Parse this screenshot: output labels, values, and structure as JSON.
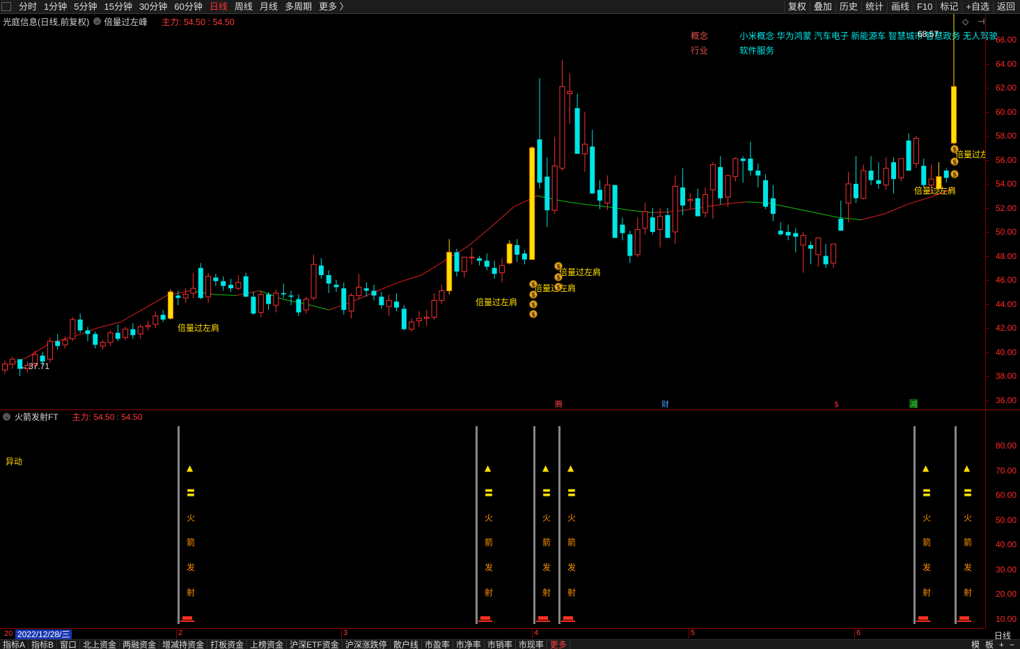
{
  "toolbar": {
    "timeframes": [
      "分时",
      "1分钟",
      "5分钟",
      "15分钟",
      "30分钟",
      "60分钟",
      "日线",
      "周线",
      "月线",
      "多周期",
      "更多 〉"
    ],
    "active_timeframe": "日线",
    "right_tools": [
      "复权",
      "叠加",
      "历史",
      "统计",
      "画线",
      "F10",
      "标记",
      "+自选",
      "返回"
    ]
  },
  "chart_header": {
    "stock_name": "光庭信息(日线,前复权)",
    "indicator_name": "倍量过左峰",
    "main_force": "主力: 54.50 : 54.50"
  },
  "concept_panel": {
    "concept_label": "概念",
    "concept_value": "小米概念 华为鸿蒙 汽车电子 新能源车 智慧城市 智慧政务 无人驾驶",
    "industry_label": "行业",
    "industry_value": "软件服务",
    "overlay_text": "68.57"
  },
  "price_axis": [
    "66.00",
    "64.00",
    "62.00",
    "60.00",
    "58.00",
    "56.00",
    "54.00",
    "52.00",
    "50.00",
    "48.00",
    "46.00",
    "44.00",
    "42.00",
    "40.00",
    "38.00",
    "36.00"
  ],
  "min_label": "←37.71",
  "signal_label": "倍量过左肩",
  "event_markers": [
    "腾",
    "财",
    "$",
    "减"
  ],
  "sub_panel": {
    "title": "火箭发射FT",
    "main_force": "主力: 54.50 : 54.50",
    "yidong_label": "异动",
    "axis": [
      "80.00",
      "70.00",
      "60.00",
      "50.00",
      "40.00",
      "30.00",
      "20.00",
      "10.00"
    ],
    "rocket_chars": [
      "▲",
      "〓",
      "火",
      "箭",
      "发",
      "射"
    ]
  },
  "date_bar": {
    "start_clip": "20",
    "selected_date": "2022/12/28/三",
    "months": [
      "2",
      "3",
      "4",
      "5",
      "6"
    ]
  },
  "period_label": "日线",
  "bottom_tabs": [
    "指标A",
    "指标B",
    "窗口",
    "北上资金",
    "两融资金",
    "增减持资金",
    "打板资金",
    "上榜资金",
    "沪深ETF资金",
    "沪深涨跌停",
    "散户线",
    "市盈率",
    "市净率",
    "市销率",
    "市现率",
    "更多"
  ],
  "bottom_right": [
    "模",
    "板",
    "+",
    "−"
  ],
  "chart_data": {
    "type": "candlestick",
    "ylim": [
      35,
      67
    ],
    "candles": [
      [
        38.5,
        39.3,
        38.2,
        39.0
      ],
      [
        39.0,
        39.6,
        38.6,
        39.4
      ],
      [
        39.4,
        39.4,
        38.0,
        38.6
      ],
      [
        38.6,
        39.2,
        38.3,
        38.9
      ],
      [
        38.9,
        40.1,
        38.7,
        39.8
      ],
      [
        39.7,
        40.0,
        38.9,
        39.2
      ],
      [
        39.4,
        41.2,
        39.1,
        40.9
      ],
      [
        40.9,
        41.5,
        40.2,
        40.5
      ],
      [
        40.6,
        41.3,
        40.3,
        41.0
      ],
      [
        41.1,
        42.9,
        40.9,
        42.7
      ],
      [
        42.7,
        43.2,
        41.6,
        41.8
      ],
      [
        41.8,
        42.1,
        40.9,
        41.5
      ],
      [
        41.5,
        41.7,
        40.3,
        40.6
      ],
      [
        40.5,
        41.0,
        40.2,
        40.8
      ],
      [
        40.8,
        41.8,
        40.5,
        41.6
      ],
      [
        41.6,
        42.3,
        40.9,
        41.1
      ],
      [
        41.2,
        42.1,
        41.0,
        41.9
      ],
      [
        41.9,
        42.4,
        41.1,
        41.4
      ],
      [
        41.5,
        42.3,
        41.1,
        42.1
      ],
      [
        42.1,
        42.6,
        41.8,
        42.2
      ],
      [
        42.3,
        43.4,
        42.0,
        43.0
      ],
      [
        43.1,
        43.5,
        42.5,
        42.7
      ],
      [
        42.8,
        45.2,
        42.7,
        45.0
      ],
      [
        44.7,
        45.1,
        43.9,
        44.5
      ],
      [
        44.5,
        45.3,
        44.1,
        44.8
      ],
      [
        44.9,
        46.6,
        44.5,
        45.3
      ],
      [
        47.0,
        47.4,
        44.4,
        44.5
      ],
      [
        44.6,
        46.6,
        44.1,
        46.3
      ],
      [
        46.2,
        46.5,
        45.5,
        45.9
      ],
      [
        45.9,
        46.3,
        45.1,
        45.5
      ],
      [
        45.6,
        46.1,
        45.0,
        45.3
      ],
      [
        45.3,
        46.4,
        45.1,
        45.8
      ],
      [
        46.3,
        46.6,
        44.7,
        44.6
      ],
      [
        44.6,
        45.0,
        43.1,
        43.2
      ],
      [
        43.3,
        45.1,
        42.9,
        44.8
      ],
      [
        44.8,
        45.0,
        43.5,
        44.0
      ],
      [
        43.9,
        45.2,
        43.3,
        44.9
      ],
      [
        44.9,
        45.7,
        44.5,
        44.8
      ],
      [
        44.7,
        45.1,
        43.9,
        44.6
      ],
      [
        44.4,
        44.8,
        43.0,
        43.3
      ],
      [
        43.5,
        44.6,
        43.2,
        44.4
      ],
      [
        44.5,
        48.1,
        44.3,
        47.3
      ],
      [
        47.2,
        47.8,
        46.1,
        46.4
      ],
      [
        46.4,
        46.8,
        44.9,
        45.7
      ],
      [
        45.6,
        46.0,
        45.0,
        45.4
      ],
      [
        45.3,
        45.8,
        43.1,
        43.5
      ],
      [
        43.4,
        44.9,
        42.8,
        44.7
      ],
      [
        44.7,
        46.5,
        44.4,
        45.4
      ],
      [
        45.3,
        45.8,
        44.6,
        45.1
      ],
      [
        45.1,
        45.6,
        44.3,
        44.7
      ],
      [
        44.6,
        45.0,
        43.6,
        43.9
      ],
      [
        43.8,
        44.8,
        43.0,
        44.3
      ],
      [
        44.2,
        44.9,
        43.4,
        43.7
      ],
      [
        43.6,
        43.9,
        41.8,
        41.9
      ],
      [
        41.9,
        42.8,
        41.7,
        42.5
      ],
      [
        42.6,
        43.4,
        42.1,
        42.8
      ],
      [
        42.8,
        43.5,
        42.2,
        42.9
      ],
      [
        42.9,
        44.9,
        42.7,
        44.3
      ],
      [
        44.3,
        45.6,
        44.0,
        45.1
      ],
      [
        45.1,
        49.4,
        44.8,
        48.3
      ],
      [
        48.3,
        48.6,
        46.3,
        46.7
      ],
      [
        46.7,
        47.8,
        46.2,
        47.9
      ],
      [
        47.9,
        48.7,
        47.3,
        47.9
      ],
      [
        47.8,
        48.0,
        47.2,
        47.6
      ],
      [
        47.6,
        48.2,
        46.8,
        47.1
      ],
      [
        47.0,
        47.6,
        46.1,
        46.5
      ],
      [
        46.6,
        47.8,
        45.8,
        47.2
      ],
      [
        47.4,
        49.3,
        47.3,
        49.0
      ],
      [
        48.9,
        49.4,
        47.5,
        48.1
      ],
      [
        48.2,
        48.5,
        47.3,
        47.7
      ],
      [
        47.7,
        57.1,
        47.7,
        57.0
      ],
      [
        57.7,
        62.8,
        53.6,
        54.1
      ],
      [
        54.6,
        56.2,
        50.4,
        51.8
      ],
      [
        51.8,
        57.9,
        51.5,
        55.5
      ],
      [
        55.3,
        64.3,
        55.1,
        62.1
      ],
      [
        61.5,
        63.2,
        59.0,
        61.7
      ],
      [
        60.3,
        61.5,
        56.5,
        56.5
      ],
      [
        56.5,
        60.0,
        55.0,
        57.3
      ],
      [
        57.1,
        58.5,
        53.4,
        53.2
      ],
      [
        53.5,
        54.3,
        51.9,
        52.6
      ],
      [
        52.4,
        54.7,
        51.8,
        53.9
      ],
      [
        53.9,
        53.6,
        49.6,
        49.5
      ],
      [
        50.6,
        51.2,
        49.3,
        49.9
      ],
      [
        49.8,
        50.1,
        47.4,
        48.0
      ],
      [
        48.1,
        51.2,
        47.9,
        50.2
      ],
      [
        50.3,
        52.4,
        49.8,
        51.7
      ],
      [
        51.2,
        52.0,
        49.8,
        50.0
      ],
      [
        50.2,
        52.0,
        48.7,
        51.3
      ],
      [
        51.4,
        52.0,
        49.7,
        49.5
      ],
      [
        50.0,
        54.7,
        49.0,
        53.8
      ],
      [
        53.7,
        55.3,
        51.4,
        52.2
      ],
      [
        52.6,
        53.2,
        51.9,
        52.7
      ],
      [
        52.8,
        53.6,
        51.4,
        51.3
      ],
      [
        51.6,
        53.7,
        51.2,
        53.1
      ],
      [
        53.5,
        55.8,
        51.1,
        55.6
      ],
      [
        55.4,
        56.3,
        52.3,
        52.8
      ],
      [
        52.9,
        54.7,
        52.1,
        54.7
      ],
      [
        54.6,
        56.2,
        54.2,
        56.1
      ],
      [
        56.1,
        56.3,
        54.1,
        55.9
      ],
      [
        56.1,
        57.5,
        54.7,
        55.1
      ],
      [
        55.1,
        55.7,
        53.7,
        54.7
      ],
      [
        54.3,
        54.8,
        51.9,
        52.1
      ],
      [
        52.8,
        53.9,
        50.9,
        51.5
      ],
      [
        50.1,
        50.8,
        49.7,
        49.8
      ],
      [
        50.0,
        50.6,
        49.3,
        49.7
      ],
      [
        49.9,
        50.3,
        48.3,
        49.6
      ],
      [
        48.9,
        50.0,
        46.6,
        49.7
      ],
      [
        48.9,
        49.2,
        47.3,
        48.6
      ],
      [
        48.1,
        49.1,
        47.1,
        49.5
      ],
      [
        48.0,
        49.0,
        47.0,
        47.3
      ],
      [
        47.4,
        49.0,
        47.0,
        49.0
      ],
      [
        51.1,
        52.6,
        50.1,
        50.1
      ],
      [
        52.4,
        55.0,
        50.8,
        54.0
      ],
      [
        54.0,
        56.3,
        52.4,
        52.8
      ],
      [
        52.8,
        55.6,
        52.7,
        55.1
      ],
      [
        55.1,
        56.3,
        53.9,
        54.3
      ],
      [
        54.3,
        55.8,
        53.6,
        54.0
      ],
      [
        53.9,
        56.2,
        53.5,
        55.3
      ],
      [
        55.8,
        56.2,
        53.2,
        54.4
      ],
      [
        54.5,
        56.1,
        54.2,
        56.1
      ],
      [
        57.6,
        58.2,
        55.3,
        55.1
      ],
      [
        55.7,
        58.0,
        55.3,
        57.8
      ],
      [
        55.5,
        56.1,
        53.7,
        53.9
      ],
      [
        53.9,
        55.6,
        53.2,
        54.4
      ],
      [
        54.6,
        55.8,
        53.3,
        53.6
      ],
      [
        55.1,
        55.3,
        54.1,
        54.5
      ],
      [
        57.4,
        68.6,
        57.3,
        62.1
      ]
    ],
    "ma": [
      [
        38.8,
        39.1
      ],
      [
        39.6,
        39.4
      ],
      [
        40.8,
        39.9
      ],
      [
        41.3,
        40.4
      ],
      [
        42.0,
        41.0
      ],
      [
        42.5,
        41.8
      ],
      [
        43.6,
        43.3
      ],
      [
        44.7,
        44.6
      ],
      [
        45.1,
        45.2
      ],
      [
        44.8,
        44.6
      ],
      [
        44.7,
        44.4
      ],
      [
        45.1,
        45.0
      ],
      [
        44.4,
        44.2
      ],
      [
        44.0,
        43.8
      ],
      [
        43.5,
        43.8
      ],
      [
        44.2,
        44.4
      ],
      [
        45.0,
        45.5
      ],
      [
        45.8,
        46.3
      ],
      [
        46.4,
        47.6
      ],
      [
        47.6,
        49.3
      ],
      [
        48.8,
        51.2
      ],
      [
        50.4,
        52.8
      ],
      [
        52.1,
        53.0
      ],
      [
        53.0,
        52.7
      ],
      [
        52.6,
        52.4
      ],
      [
        52.3,
        52.0
      ],
      [
        52.1,
        51.7
      ],
      [
        51.8,
        51.6
      ],
      [
        51.6,
        51.8
      ],
      [
        51.7,
        52.4
      ],
      [
        52.0,
        52.3
      ],
      [
        52.3,
        52.0
      ],
      [
        52.5,
        51.6
      ],
      [
        52.4,
        51.3
      ],
      [
        52.0,
        50.9
      ],
      [
        51.6,
        51.0
      ],
      [
        51.2,
        51.5
      ],
      [
        51.0,
        52.2
      ],
      [
        51.5,
        52.6
      ],
      [
        52.3,
        53.0
      ],
      [
        52.9,
        53.3
      ],
      [
        53.6,
        53.5
      ]
    ]
  }
}
